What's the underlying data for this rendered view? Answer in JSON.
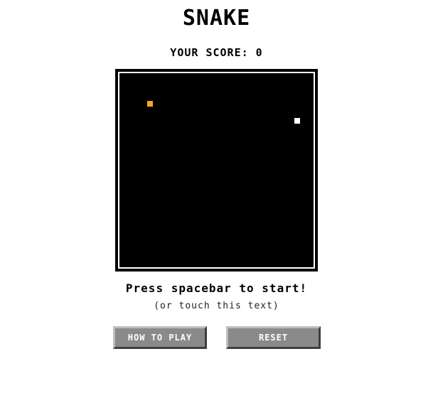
{
  "game": {
    "title": "SNAKE",
    "score_text": "YOUR SCORE: 0",
    "score": 0,
    "prompt": "Press spacebar to start!",
    "subprompt": "(or touch this text)"
  },
  "board": {
    "background": "#000000",
    "border_color": "#ffffff",
    "food_color": "#f5a623",
    "snake_color": "#ffffff"
  },
  "buttons": {
    "how_to_play": "HOW TO PLAY",
    "reset": "RESET"
  }
}
